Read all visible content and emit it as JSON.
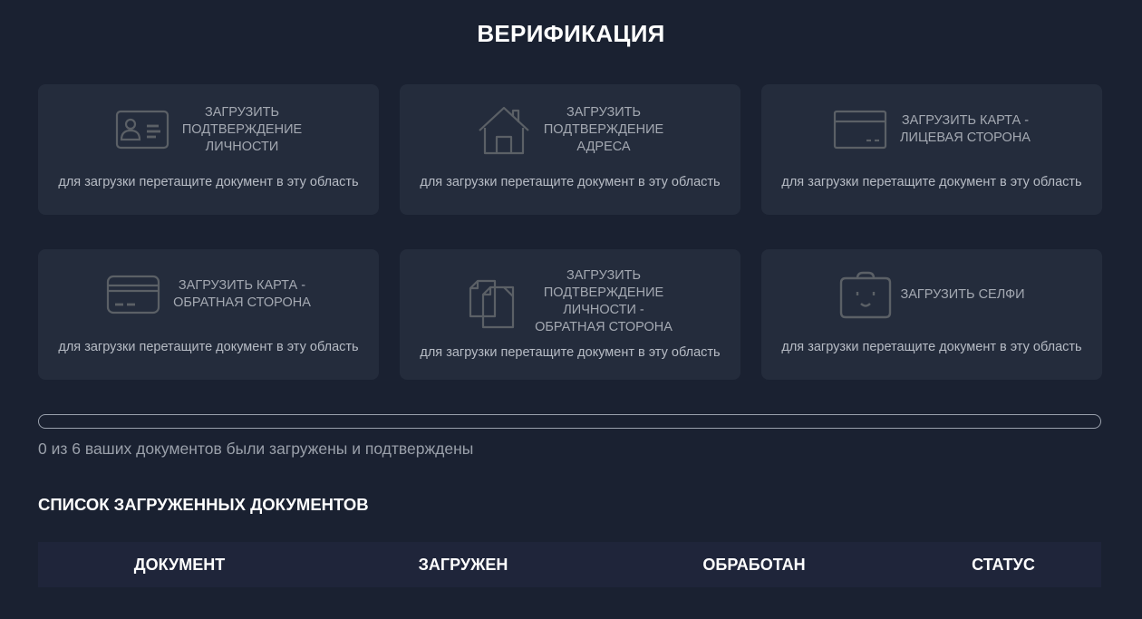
{
  "page": {
    "title": "ВЕРИФИКАЦИЯ"
  },
  "upload_cards": [
    {
      "title": "ЗАГРУЗИТЬ\nПОДТВЕРЖДЕНИЕ\nЛИЧНОСТИ",
      "icon": "id-card-icon",
      "hint": "для загрузки перетащите документ в эту область"
    },
    {
      "title": "ЗАГРУЗИТЬ\nПОДТВЕРЖДЕНИЕ\nАДРЕСА",
      "icon": "house-icon",
      "hint": "для загрузки перетащите документ в эту область"
    },
    {
      "title": "ЗАГРУЗИТЬ КАРТА -\nЛИЦЕВАЯ СТОРОНА",
      "icon": "card-front-icon",
      "hint": "для загрузки перетащите документ в эту область"
    },
    {
      "title": "ЗАГРУЗИТЬ КАРТА -\nОБРАТНАЯ СТОРОНА",
      "icon": "card-back-icon",
      "hint": "для загрузки перетащите документ в эту область"
    },
    {
      "title": "ЗАГРУЗИТЬ\nПОДТВЕРЖДЕНИЕ\nЛИЧНОСТИ -\nОБРАТНАЯ СТОРОНА",
      "icon": "document-pages-icon",
      "hint": "для загрузки перетащите документ в эту область"
    },
    {
      "title": "ЗАГРУЗИТЬ СЕЛФИ",
      "icon": "selfie-camera-icon",
      "hint": "для загрузки перетащите документ в эту область"
    }
  ],
  "progress": {
    "uploaded_count": 0,
    "total_count": 6,
    "text": "0 из 6 ваших документов были загружены и подтверждены",
    "fill_color": "#3a8ee6"
  },
  "documents_section": {
    "title": "СПИСОК ЗАГРУЖЕННЫХ ДОКУМЕНТОВ",
    "columns": [
      "ДОКУМЕНТ",
      "ЗАГРУЖЕН",
      "ОБРАБОТАН",
      "СТАТУС"
    ]
  },
  "colors": {
    "background": "#1a2131",
    "card": "#242c3c",
    "icon": "#5b6066",
    "table_header": "#1f253a"
  }
}
